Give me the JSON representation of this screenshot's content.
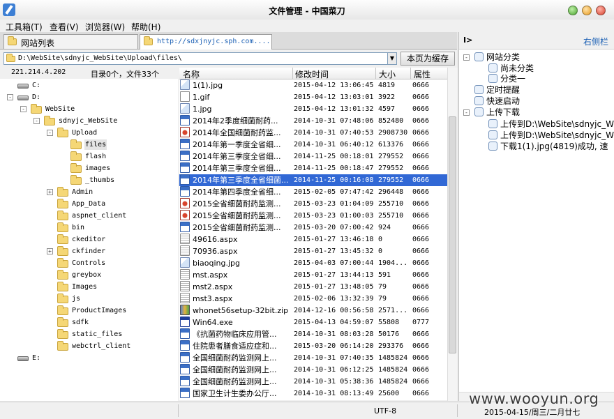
{
  "window": {
    "title": "文件管理 - 中国菜刀"
  },
  "menu": [
    "工具箱(T)",
    "查看(V)",
    "浏览器(W)",
    "帮助(H)"
  ],
  "tabs": [
    {
      "label": "网站列表",
      "active": false
    },
    {
      "label": "http://sdxjnyjc.sph.com....",
      "active": true
    }
  ],
  "address": {
    "value": "D:\\WebSite\\sdnyjc_WebSite\\Upload\\files\\",
    "cache_button": "本页为缓存"
  },
  "tree_header": {
    "ip": "221.214.4.202",
    "summary": "目录0个，文件33个"
  },
  "columns": {
    "name": "名称",
    "time": "修改时间",
    "size": "大小",
    "attr": "属性"
  },
  "tree": [
    {
      "label": "C:",
      "type": "drive",
      "expander": ""
    },
    {
      "label": "D:",
      "type": "drive",
      "expander": "-"
    },
    {
      "label": "WebSite",
      "type": "folder",
      "expander": "-"
    },
    {
      "label": "sdnyjc_WebSite",
      "type": "folder",
      "expander": "-"
    },
    {
      "label": "Upload",
      "type": "folder",
      "expander": "-"
    },
    {
      "label": "files",
      "type": "folder",
      "expander": "",
      "selected": true
    },
    {
      "label": "flash",
      "type": "folder",
      "expander": ""
    },
    {
      "label": "images",
      "type": "folder",
      "expander": ""
    },
    {
      "label": "_thumbs",
      "type": "folder",
      "expander": ""
    },
    {
      "label": "Admin",
      "type": "folder",
      "expander": "+"
    },
    {
      "label": "App_Data",
      "type": "folder",
      "expander": ""
    },
    {
      "label": "aspnet_client",
      "type": "folder",
      "expander": ""
    },
    {
      "label": "bin",
      "type": "folder",
      "expander": ""
    },
    {
      "label": "ckeditor",
      "type": "folder",
      "expander": ""
    },
    {
      "label": "ckfinder",
      "type": "folder",
      "expander": "+"
    },
    {
      "label": "Controls",
      "type": "folder",
      "expander": ""
    },
    {
      "label": "greybox",
      "type": "folder",
      "expander": ""
    },
    {
      "label": "Images",
      "type": "folder",
      "expander": ""
    },
    {
      "label": "js",
      "type": "folder",
      "expander": ""
    },
    {
      "label": "ProductImages",
      "type": "folder",
      "expander": ""
    },
    {
      "label": "sdfk",
      "type": "folder",
      "expander": ""
    },
    {
      "label": "static_files",
      "type": "folder",
      "expander": ""
    },
    {
      "label": "webctrl_client",
      "type": "folder",
      "expander": ""
    },
    {
      "label": "E:",
      "type": "drive",
      "expander": ""
    }
  ],
  "files": [
    {
      "name": "1(1).jpg",
      "time": "2015-04-12 13:06:45",
      "size": "4819",
      "attr": "0666",
      "icon": "image-file-icon"
    },
    {
      "name": "1.gif",
      "time": "2015-04-12 13:03:01",
      "size": "3922",
      "attr": "0666",
      "icon": "generic-file-icon"
    },
    {
      "name": "1.jpg",
      "time": "2015-04-12 13:01:32",
      "size": "4597",
      "attr": "0666",
      "icon": "image-file-icon"
    },
    {
      "name": "2014年2季度细菌耐药...",
      "time": "2014-10-31 07:48:06",
      "size": "852480",
      "attr": "0666",
      "icon": "word-file-icon"
    },
    {
      "name": "2014年全国细菌耐药监...",
      "time": "2014-10-31 07:40:53",
      "size": "2908730",
      "attr": "0666",
      "icon": "pdf-file-icon"
    },
    {
      "name": "2014年第一季度全省细...",
      "time": "2014-10-31 06:40:12",
      "size": "613376",
      "attr": "0666",
      "icon": "word-file-icon"
    },
    {
      "name": "2014年第三季度全省细...",
      "time": "2014-11-25 00:18:01",
      "size": "279552",
      "attr": "0666",
      "icon": "word-file-icon"
    },
    {
      "name": "2014年第三季度全省细...",
      "time": "2014-11-25 00:18:47",
      "size": "279552",
      "attr": "0666",
      "icon": "word-file-icon"
    },
    {
      "name": "2014年第三季度全省细菌...",
      "time": "2014-11-25 00:16:08",
      "size": "279552",
      "attr": "0666",
      "icon": "word-file-icon",
      "selected": true
    },
    {
      "name": "2014年第四季度全省细...",
      "time": "2015-02-05 07:47:42",
      "size": "296448",
      "attr": "0666",
      "icon": "word-file-icon"
    },
    {
      "name": "2015全省细菌耐药监测...",
      "time": "2015-03-23 01:04:09",
      "size": "255710",
      "attr": "0666",
      "icon": "pdf-file-icon"
    },
    {
      "name": "2015全省细菌耐药监测...",
      "time": "2015-03-23 01:00:03",
      "size": "255710",
      "attr": "0666",
      "icon": "pdf-file-icon"
    },
    {
      "name": "2015全省细菌耐药监测...",
      "time": "2015-03-20 07:00:42",
      "size": "924",
      "attr": "0666",
      "icon": "word-file-icon"
    },
    {
      "name": "49616.aspx",
      "time": "2015-01-27 13:46:18",
      "size": "0",
      "attr": "0666",
      "icon": "text-file-icon"
    },
    {
      "name": "70936.aspx",
      "time": "2015-01-27 13:45:32",
      "size": "0",
      "attr": "0666",
      "icon": "text-file-icon"
    },
    {
      "name": "biaoqing.jpg",
      "time": "2015-04-03 07:00:44",
      "size": "1904...",
      "attr": "0666",
      "icon": "image-file-icon"
    },
    {
      "name": "mst.aspx",
      "time": "2015-01-27 13:44:13",
      "size": "591",
      "attr": "0666",
      "icon": "text-file-icon"
    },
    {
      "name": "mst2.aspx",
      "time": "2015-01-27 13:48:05",
      "size": "79",
      "attr": "0666",
      "icon": "text-file-icon"
    },
    {
      "name": "mst3.aspx",
      "time": "2015-02-06 13:32:39",
      "size": "79",
      "attr": "0666",
      "icon": "text-file-icon"
    },
    {
      "name": "whonet56setup-32bit.zip",
      "time": "2014-12-16 00:56:58",
      "size": "2571...",
      "attr": "0666",
      "icon": "zip-file-icon"
    },
    {
      "name": "Win64.exe",
      "time": "2015-04-13 04:59:07",
      "size": "55808",
      "attr": "0777",
      "icon": "exe-file-icon"
    },
    {
      "name": "《抗菌药物临床应用管...",
      "time": "2014-10-31 08:03:28",
      "size": "50176",
      "attr": "0666",
      "icon": "word-file-icon"
    },
    {
      "name": "住院患者膳食适应症和...",
      "time": "2015-03-20 06:14:20",
      "size": "293376",
      "attr": "0666",
      "icon": "word-file-icon"
    },
    {
      "name": "全国细菌耐药监测网上...",
      "time": "2014-10-31 07:40:35",
      "size": "1485824",
      "attr": "0666",
      "icon": "word-file-icon"
    },
    {
      "name": "全国细菌耐药监测网上...",
      "time": "2014-10-31 06:12:25",
      "size": "1485824",
      "attr": "0666",
      "icon": "word-file-icon"
    },
    {
      "name": "全国细菌耐药监测网上...",
      "time": "2014-10-31 05:38:36",
      "size": "1485824",
      "attr": "0666",
      "icon": "word-file-icon"
    },
    {
      "name": "国家卫生计生委办公厅...",
      "time": "2014-10-31 08:13:49",
      "size": "25600",
      "attr": "0666",
      "icon": "word-file-icon"
    }
  ],
  "right_panel": {
    "title_left": "I>",
    "title_right": "右侧栏",
    "nodes": [
      {
        "label": "网站分类",
        "expander": "-",
        "icon": "category-icon"
      },
      {
        "label": "尚未分类",
        "expander": "",
        "icon": "category-icon"
      },
      {
        "label": "分类一",
        "expander": "",
        "icon": "category-icon"
      },
      {
        "label": "定时提醒",
        "expander": "",
        "icon": "clock-icon"
      },
      {
        "label": "快速启动",
        "expander": "",
        "icon": "launch-icon"
      },
      {
        "label": "上传下载",
        "expander": "-",
        "icon": "transfer-icon"
      },
      {
        "label": "上传到D:\\WebSite\\sdnyjc_We",
        "expander": "",
        "icon": "upload-icon"
      },
      {
        "label": "上传到D:\\WebSite\\sdnyjc_We",
        "expander": "",
        "icon": "upload-icon"
      },
      {
        "label": "下载1(1).jpg(4819)成功, 速",
        "expander": "",
        "icon": "download-icon"
      }
    ]
  },
  "status": {
    "encoding": "UTF-8",
    "date": "2015-04-15/周三/二月廿七"
  },
  "watermark": "www.wooyun.org",
  "colors": {
    "selection": "#3168d5",
    "folder": "#f5d776",
    "link": "#1a5fb4"
  }
}
